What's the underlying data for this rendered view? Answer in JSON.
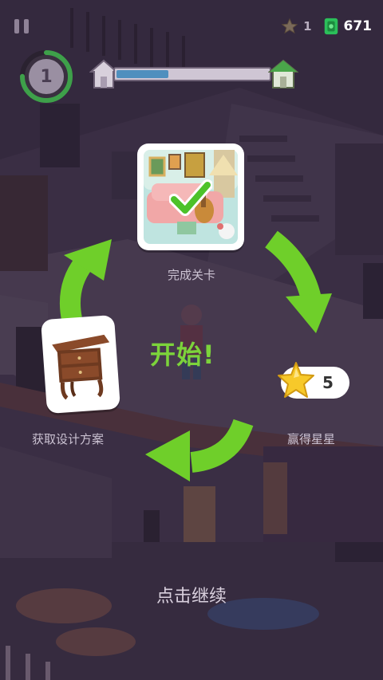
{
  "hud": {
    "stars": "1",
    "cash": "671",
    "level": "1",
    "level_progress": 0.75,
    "house_progress": 0.34
  },
  "tutorial": {
    "step_complete_level": "完成关卡",
    "step_get_design": "获取设计方案",
    "step_earn_stars": "赢得星星",
    "start": "开始!",
    "stars_earned": "5",
    "tap_to_continue": "点击继续"
  },
  "colors": {
    "arrow_green": "#6fcf2a",
    "start_green": "#7cd33b",
    "progress_blue": "#4f8fbe",
    "star_yellow": "#f7c92a"
  },
  "icons": [
    "pause-icon",
    "star-icon",
    "cash-icon",
    "checkmark-icon",
    "nightstand-icon",
    "arrow-icon"
  ]
}
